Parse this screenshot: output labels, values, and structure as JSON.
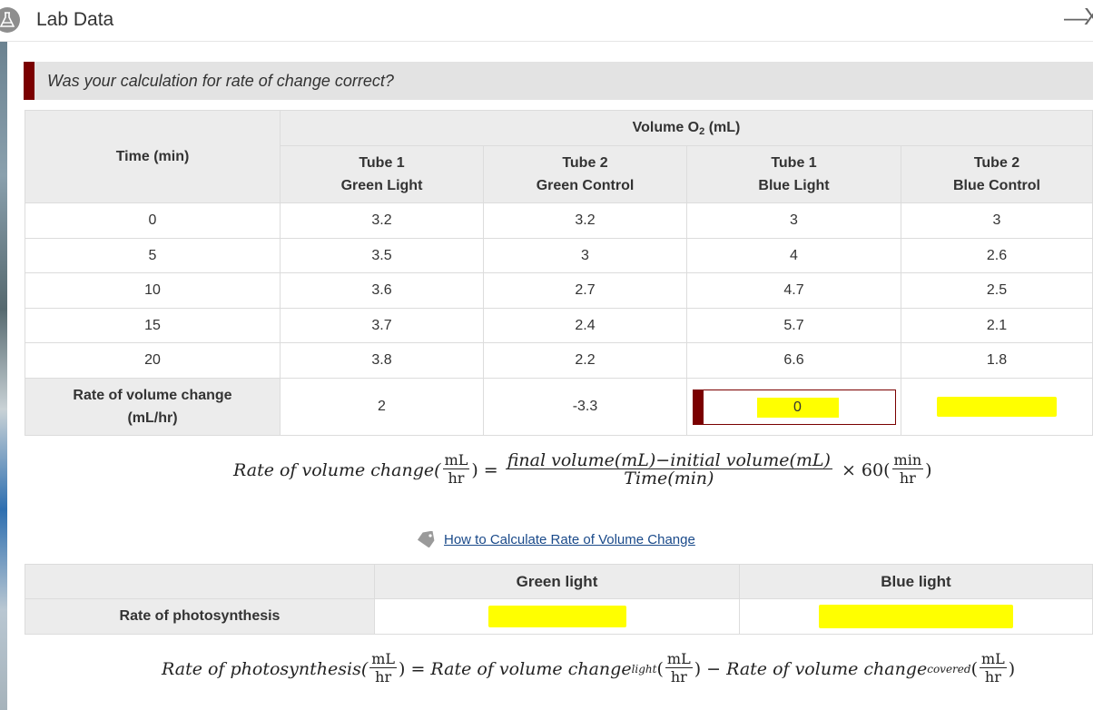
{
  "window": {
    "title": "Lab Data",
    "minimize_glyph": "—",
    "close_glyph": "X",
    "icon": "flask-icon"
  },
  "question": "Was your calculation for rate of change correct?",
  "colors": {
    "accent": "#7a0000",
    "highlight": "#ffff00",
    "header_bg": "#ececec",
    "link": "#1a4a8a"
  },
  "table": {
    "time_header": "Time (min)",
    "volume_header_main": "Volume O",
    "volume_header_sub": "2",
    "volume_header_unit": " (mL)",
    "columns": [
      {
        "line1": "Tube 1",
        "line2": "Green Light"
      },
      {
        "line1": "Tube 2",
        "line2": "Green Control"
      },
      {
        "line1": "Tube 1",
        "line2": "Blue Light"
      },
      {
        "line1": "Tube 2",
        "line2": "Blue Control"
      }
    ],
    "rows": [
      {
        "time": "0",
        "values": [
          "3.2",
          "3.2",
          "3",
          "3"
        ]
      },
      {
        "time": "5",
        "values": [
          "3.5",
          "3",
          "4",
          "2.6"
        ]
      },
      {
        "time": "10",
        "values": [
          "3.6",
          "2.7",
          "4.7",
          "2.5"
        ]
      },
      {
        "time": "15",
        "values": [
          "3.7",
          "2.4",
          "5.7",
          "2.1"
        ]
      },
      {
        "time": "20",
        "values": [
          "3.8",
          "2.2",
          "6.6",
          "1.8"
        ]
      }
    ],
    "rate_label_line1": "Rate of volume change",
    "rate_label_line2": "(mL/hr)",
    "rate_values": [
      "2",
      "-3.3"
    ],
    "rate_input_value": "0"
  },
  "formula1": {
    "lhs": "Rate of volume change(",
    "unit_num": "mL",
    "unit_den": "hr",
    "eq": ") =",
    "frac_num": "final volume(mL)−initial volume(mL)",
    "frac_den": "Time(min)",
    "times": "× 60(",
    "min_num": "min",
    "min_den": "hr",
    "close": ")"
  },
  "link": {
    "text": "How to Calculate Rate of Volume Change",
    "icon": "tag-icon"
  },
  "photosynthesis": {
    "col_green": "Green light",
    "col_blue": "Blue light",
    "row_label": "Rate of photosynthesis"
  },
  "formula2": {
    "lhs": "Rate of photosynthesis(",
    "unit_num": "mL",
    "unit_den": "hr",
    "eq": ") =",
    "term1": "Rate of volume change",
    "term1_sub": "light",
    "open1": "(",
    "close_minus": ") −",
    "term2": "Rate of volume change",
    "term2_sub": "covered",
    "open2": "(",
    "close": ")"
  }
}
